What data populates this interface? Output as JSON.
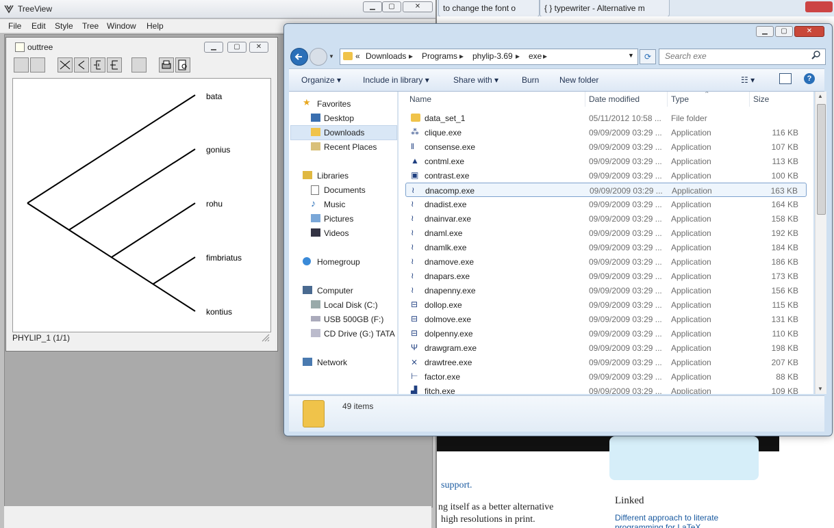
{
  "browser": {
    "tab1": "to change the font o",
    "tab2": "{ } typewriter - Alternative m",
    "page_text": {
      "support": "support.",
      "line1": "ng itself as a better alternative",
      "line2": "high resolutions in print.",
      "linked": "Linked",
      "link1": "Different approach to literate",
      "link2": "programming for LaTeX"
    }
  },
  "treeview": {
    "title": "TreeView",
    "menu": [
      "File",
      "Edit",
      "Style",
      "Tree",
      "Window",
      "Help"
    ],
    "child_title": "outtree",
    "leaves": [
      "bata",
      "gonius",
      "rohu",
      "fimbriatus",
      "kontius"
    ],
    "status": "PHYLIP_1  (1/1)"
  },
  "explorer": {
    "breadcrumb": [
      "«",
      "Downloads",
      "Programs",
      "phylip-3.69",
      "exe"
    ],
    "search_placeholder": "Search exe",
    "commands": {
      "organize": "Organize",
      "include": "Include in library",
      "share": "Share with",
      "burn": "Burn",
      "new_folder": "New folder"
    },
    "nav": {
      "favorites": "Favorites",
      "desktop": "Desktop",
      "downloads": "Downloads",
      "recent": "Recent Places",
      "libraries": "Libraries",
      "documents": "Documents",
      "music": "Music",
      "pictures": "Pictures",
      "videos": "Videos",
      "homegroup": "Homegroup",
      "computer": "Computer",
      "local_disk": "Local Disk (C:)",
      "usb": "USB 500GB (F:)",
      "cd": "CD Drive (G:) TATA I",
      "network": "Network"
    },
    "columns": {
      "name": "Name",
      "date": "Date modified",
      "type": "Type",
      "size": "Size"
    },
    "files": [
      {
        "name": "data_set_1",
        "date": "05/11/2012 10:58 ...",
        "type": "File folder",
        "size": ""
      },
      {
        "name": "clique.exe",
        "date": "09/09/2009 03:29 ...",
        "type": "Application",
        "size": "116 KB"
      },
      {
        "name": "consense.exe",
        "date": "09/09/2009 03:29 ...",
        "type": "Application",
        "size": "107 KB"
      },
      {
        "name": "contml.exe",
        "date": "09/09/2009 03:29 ...",
        "type": "Application",
        "size": "113 KB"
      },
      {
        "name": "contrast.exe",
        "date": "09/09/2009 03:29 ...",
        "type": "Application",
        "size": "100 KB"
      },
      {
        "name": "dnacomp.exe",
        "date": "09/09/2009 03:29 ...",
        "type": "Application",
        "size": "163 KB"
      },
      {
        "name": "dnadist.exe",
        "date": "09/09/2009 03:29 ...",
        "type": "Application",
        "size": "164 KB"
      },
      {
        "name": "dnainvar.exe",
        "date": "09/09/2009 03:29 ...",
        "type": "Application",
        "size": "158 KB"
      },
      {
        "name": "dnaml.exe",
        "date": "09/09/2009 03:29 ...",
        "type": "Application",
        "size": "192 KB"
      },
      {
        "name": "dnamlk.exe",
        "date": "09/09/2009 03:29 ...",
        "type": "Application",
        "size": "184 KB"
      },
      {
        "name": "dnamove.exe",
        "date": "09/09/2009 03:29 ...",
        "type": "Application",
        "size": "186 KB"
      },
      {
        "name": "dnapars.exe",
        "date": "09/09/2009 03:29 ...",
        "type": "Application",
        "size": "173 KB"
      },
      {
        "name": "dnapenny.exe",
        "date": "09/09/2009 03:29 ...",
        "type": "Application",
        "size": "156 KB"
      },
      {
        "name": "dollop.exe",
        "date": "09/09/2009 03:29 ...",
        "type": "Application",
        "size": "115 KB"
      },
      {
        "name": "dolmove.exe",
        "date": "09/09/2009 03:29 ...",
        "type": "Application",
        "size": "131 KB"
      },
      {
        "name": "dolpenny.exe",
        "date": "09/09/2009 03:29 ...",
        "type": "Application",
        "size": "110 KB"
      },
      {
        "name": "drawgram.exe",
        "date": "09/09/2009 03:29 ...",
        "type": "Application",
        "size": "198 KB"
      },
      {
        "name": "drawtree.exe",
        "date": "09/09/2009 03:29 ...",
        "type": "Application",
        "size": "207 KB"
      },
      {
        "name": "factor.exe",
        "date": "09/09/2009 03:29 ...",
        "type": "Application",
        "size": "88 KB"
      },
      {
        "name": "fitch.exe",
        "date": "09/09/2009 03:29 ...",
        "type": "Application",
        "size": "109 KB"
      }
    ],
    "selected_index": 5,
    "item_count": "49 items"
  },
  "colors": {
    "accent": "#3399ff",
    "selection": "#cce8ff",
    "folder": "#f0c34a"
  }
}
